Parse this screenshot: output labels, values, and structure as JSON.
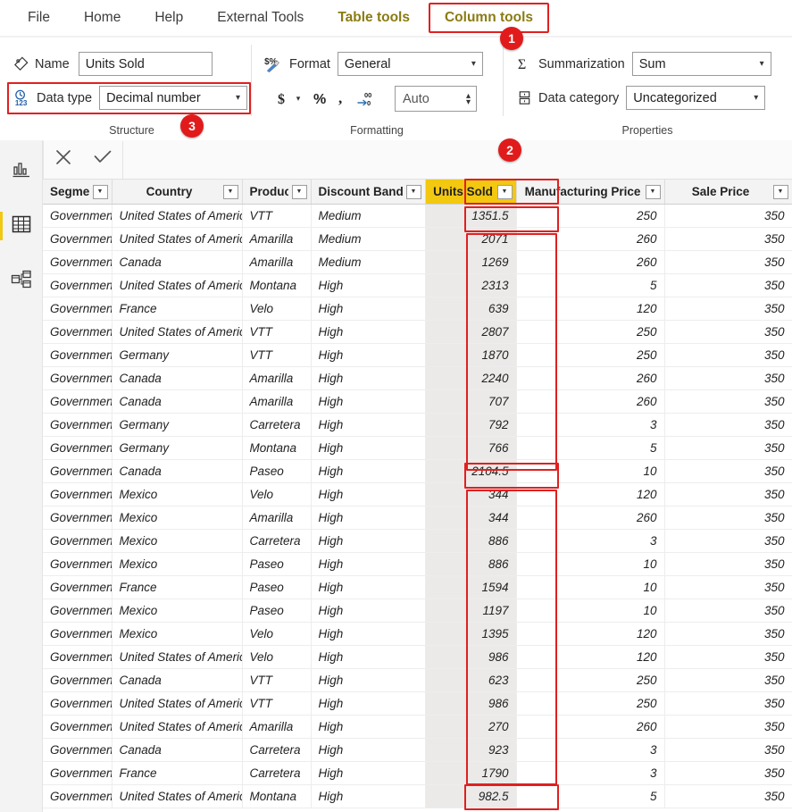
{
  "ribbon": {
    "tabs": [
      {
        "label": "File",
        "state": "normal"
      },
      {
        "label": "Home",
        "state": "normal"
      },
      {
        "label": "Help",
        "state": "normal"
      },
      {
        "label": "External Tools",
        "state": "normal"
      },
      {
        "label": "Table tools",
        "state": "contextual"
      },
      {
        "label": "Column tools",
        "state": "active"
      }
    ],
    "structure": {
      "group_label": "Structure",
      "name_label": "Name",
      "name_value": "Units Sold",
      "data_type_label": "Data type",
      "data_type_value": "Decimal number"
    },
    "formatting": {
      "group_label": "Formatting",
      "format_label": "Format",
      "format_value": "General",
      "currency_icon": "currency-dollar-icon",
      "percent_icon": "percent-icon",
      "comma_icon": "thousands-separator-icon",
      "decimal_icon": "decimal-places-icon",
      "decimals_value": "Auto"
    },
    "properties": {
      "group_label": "Properties",
      "summarization_label": "Summarization",
      "summarization_value": "Sum",
      "data_category_label": "Data category",
      "data_category_value": "Uncategorized"
    }
  },
  "annotations": [
    {
      "number": "1"
    },
    {
      "number": "2"
    },
    {
      "number": "3"
    }
  ],
  "rail": {
    "items": [
      {
        "name": "report-view",
        "icon": "bar-chart-icon",
        "selected": false
      },
      {
        "name": "data-view",
        "icon": "table-grid-icon",
        "selected": true
      },
      {
        "name": "model-view",
        "icon": "model-relationship-icon",
        "selected": false
      }
    ]
  },
  "formula_bar": {
    "cancel_icon": "close-x-icon",
    "confirm_icon": "check-icon",
    "input_value": ""
  },
  "table": {
    "selected_column": "Units Sold",
    "columns": [
      {
        "label": "Segment",
        "align": "left",
        "filter": true
      },
      {
        "label": "Country",
        "align": "center",
        "filter": true
      },
      {
        "label": "Product",
        "align": "left",
        "filter": true
      },
      {
        "label": "Discount Band",
        "align": "left",
        "filter": true
      },
      {
        "label": "Units Sold",
        "align": "left",
        "filter": true
      },
      {
        "label": "Manufacturing Price",
        "align": "left",
        "filter": true
      },
      {
        "label": "Sale Price",
        "align": "left",
        "filter": true
      }
    ],
    "rows": [
      [
        "Government",
        "United States of America",
        "VTT",
        "Medium",
        "1351.5",
        "250",
        "350"
      ],
      [
        "Government",
        "United States of America",
        "Amarilla",
        "Medium",
        "2071",
        "260",
        "350"
      ],
      [
        "Government",
        "Canada",
        "Amarilla",
        "Medium",
        "1269",
        "260",
        "350"
      ],
      [
        "Government",
        "United States of America",
        "Montana",
        "High",
        "2313",
        "5",
        "350"
      ],
      [
        "Government",
        "France",
        "Velo",
        "High",
        "639",
        "120",
        "350"
      ],
      [
        "Government",
        "United States of America",
        "VTT",
        "High",
        "2807",
        "250",
        "350"
      ],
      [
        "Government",
        "Germany",
        "VTT",
        "High",
        "1870",
        "250",
        "350"
      ],
      [
        "Government",
        "Canada",
        "Amarilla",
        "High",
        "2240",
        "260",
        "350"
      ],
      [
        "Government",
        "Canada",
        "Amarilla",
        "High",
        "707",
        "260",
        "350"
      ],
      [
        "Government",
        "Germany",
        "Carretera",
        "High",
        "792",
        "3",
        "350"
      ],
      [
        "Government",
        "Germany",
        "Montana",
        "High",
        "766",
        "5",
        "350"
      ],
      [
        "Government",
        "Canada",
        "Paseo",
        "High",
        "2104.5",
        "10",
        "350"
      ],
      [
        "Government",
        "Mexico",
        "Velo",
        "High",
        "344",
        "120",
        "350"
      ],
      [
        "Government",
        "Mexico",
        "Amarilla",
        "High",
        "344",
        "260",
        "350"
      ],
      [
        "Government",
        "Mexico",
        "Carretera",
        "High",
        "886",
        "3",
        "350"
      ],
      [
        "Government",
        "Mexico",
        "Paseo",
        "High",
        "886",
        "10",
        "350"
      ],
      [
        "Government",
        "France",
        "Paseo",
        "High",
        "1594",
        "10",
        "350"
      ],
      [
        "Government",
        "Mexico",
        "Paseo",
        "High",
        "1197",
        "10",
        "350"
      ],
      [
        "Government",
        "Mexico",
        "Velo",
        "High",
        "1395",
        "120",
        "350"
      ],
      [
        "Government",
        "United States of America",
        "Velo",
        "High",
        "986",
        "120",
        "350"
      ],
      [
        "Government",
        "Canada",
        "VTT",
        "High",
        "623",
        "250",
        "350"
      ],
      [
        "Government",
        "United States of America",
        "VTT",
        "High",
        "986",
        "250",
        "350"
      ],
      [
        "Government",
        "United States of America",
        "Amarilla",
        "High",
        "270",
        "260",
        "350"
      ],
      [
        "Government",
        "Canada",
        "Carretera",
        "High",
        "923",
        "3",
        "350"
      ],
      [
        "Government",
        "France",
        "Carretera",
        "High",
        "1790",
        "3",
        "350"
      ],
      [
        "Government",
        "United States of America",
        "Montana",
        "High",
        "982.5",
        "5",
        "350"
      ]
    ]
  },
  "colors": {
    "accent_yellow": "#f2c811",
    "contextual_tab_text": "#8a7b12",
    "annotation_red": "#e02020",
    "selected_cell_bg": "#eceae8"
  }
}
